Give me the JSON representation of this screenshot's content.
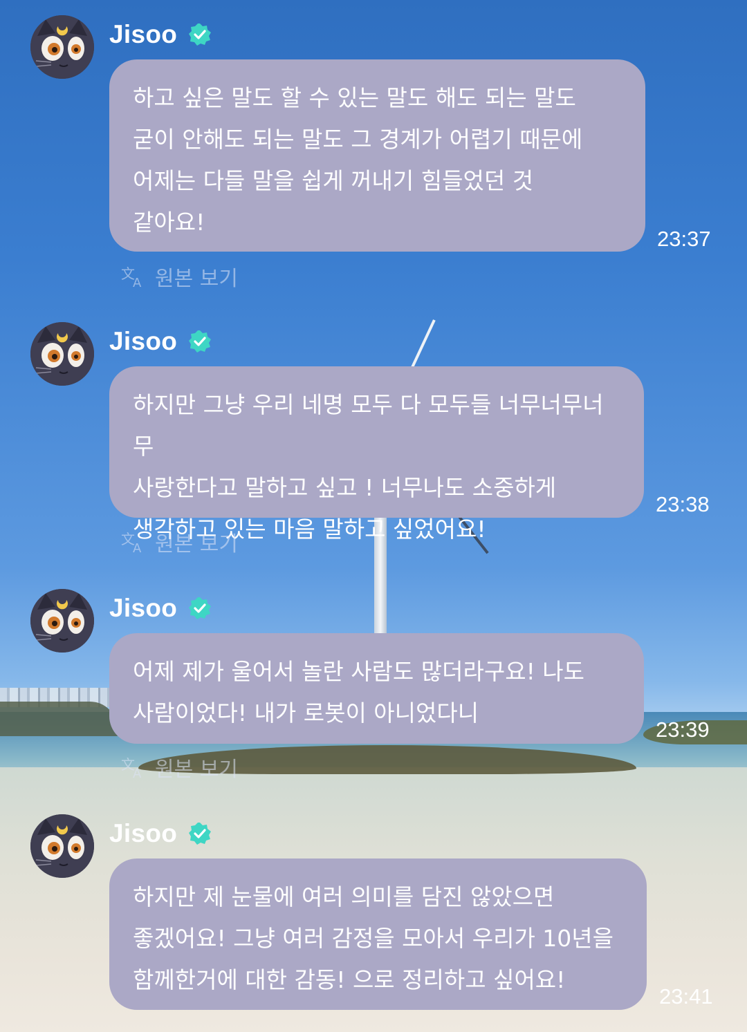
{
  "chat": {
    "messages": [
      {
        "sender": "Jisoo",
        "text": "하고 싶은 말도 할 수 있는 말도 해도 되는 말도\n굳이 안해도 되는 말도 그 경계가 어렵기 때문에\n어제는 다들 말을 쉽게 꺼내기 힘들었던 것\n같아요!",
        "time": "23:37",
        "translate_label": "원본 보기"
      },
      {
        "sender": "Jisoo",
        "text": "하지만 그냥 우리 네명 모두 다 모두들 너무너무너무\n사랑한다고 말하고 싶고 ! 너무나도 소중하게\n생각하고 있는 마음 말하고 싶었어요!",
        "time": "23:38",
        "translate_label": "원본 보기"
      },
      {
        "sender": "Jisoo",
        "text": "어제 제가 울어서 놀란 사람도 많더라구요! 나도\n사람이었다! 내가 로봇이 아니었다니",
        "time": "23:39",
        "translate_label": "원본 보기"
      },
      {
        "sender": "Jisoo",
        "text": "하지만 제 눈물에 여러 의미를 담진 않았으면\n좋겠어요! 그냥 여러 감정을 모아서 우리가 10년을\n함께한거에 대한 감동! 으로 정리하고 싶어요!",
        "time": "23:41"
      }
    ]
  },
  "icons": {
    "verified": "verified-check-badge-icon",
    "translate": "translate-icon",
    "avatar": "black-cat-avatar"
  },
  "colors": {
    "bubble": "#aba8c6",
    "verified_badge": "#3ed6c4",
    "text": "#ffffff"
  }
}
